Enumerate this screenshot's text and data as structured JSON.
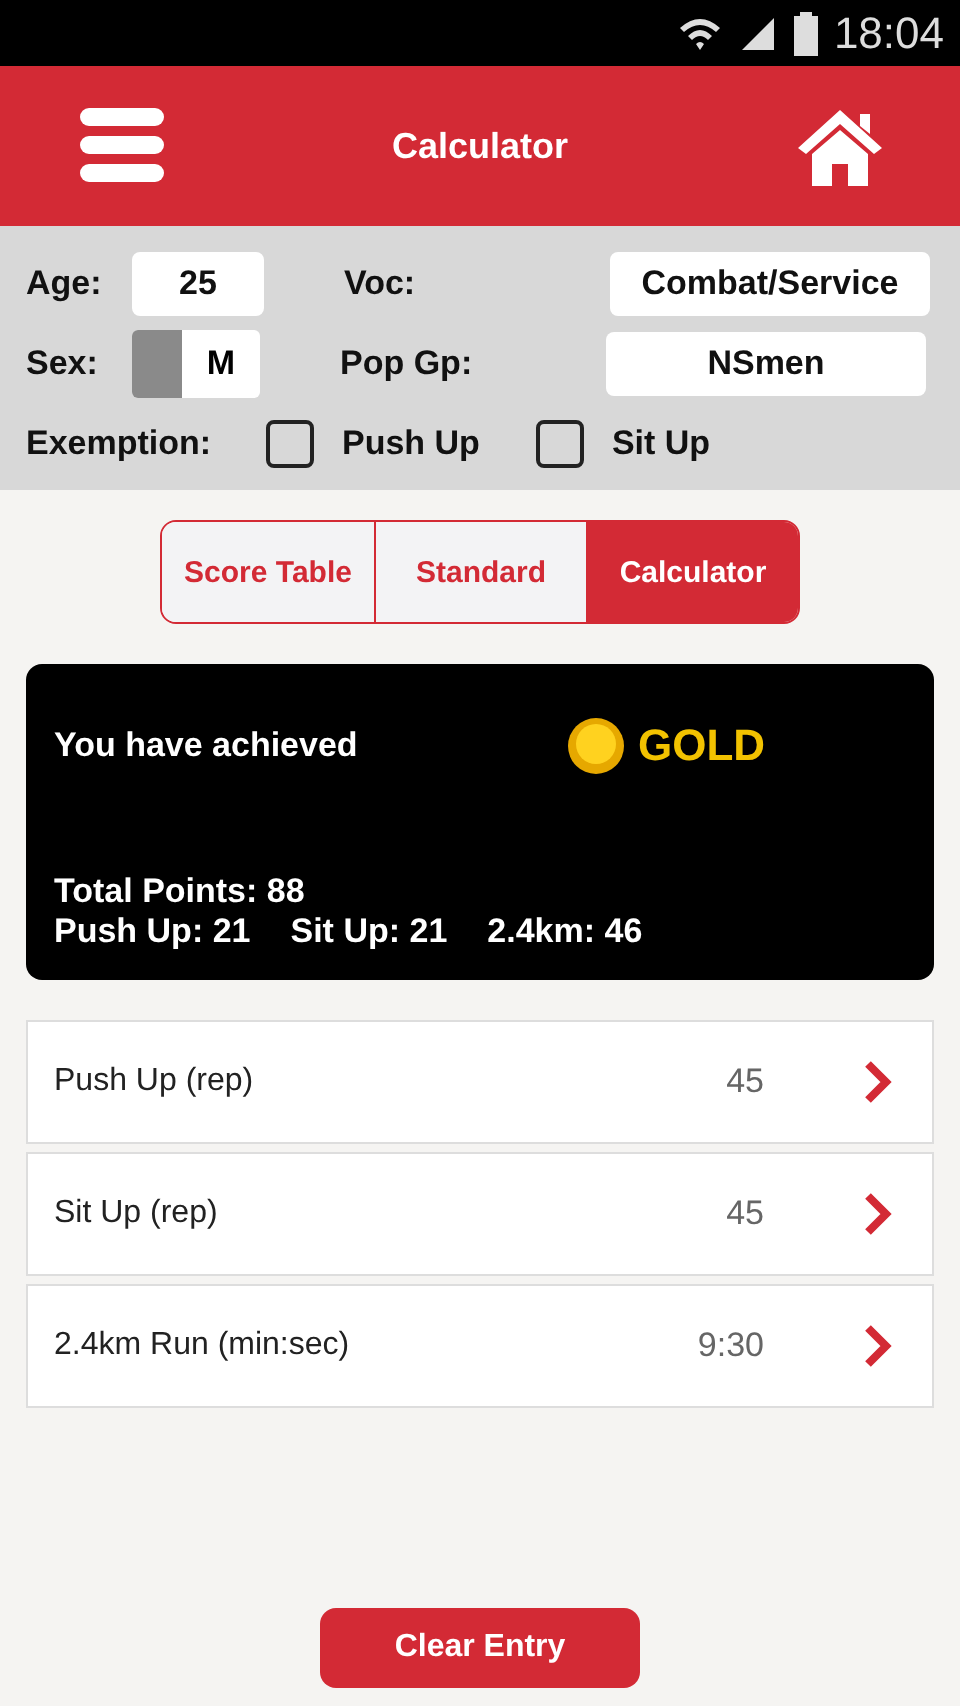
{
  "status_bar": {
    "time": "18:04"
  },
  "header": {
    "title": "Calculator"
  },
  "form": {
    "age_label": "Age:",
    "age": "25",
    "voc_label": "Voc:",
    "voc": "Combat/Service",
    "sex_label": "Sex:",
    "sex": "M",
    "pop_label": "Pop Gp:",
    "pop": "NSmen",
    "exemption_label": "Exemption:",
    "exemptions": [
      {
        "label": "Push Up",
        "checked": false
      },
      {
        "label": "Sit Up",
        "checked": false
      }
    ]
  },
  "tabs": [
    {
      "label": "Score Table",
      "selected": false
    },
    {
      "label": "Standard",
      "selected": false
    },
    {
      "label": "Calculator",
      "selected": true
    }
  ],
  "result": {
    "heading": "You have achieved",
    "award": "GOLD",
    "total": "Total Points: 88",
    "stats": [
      "Push Up: 21",
      "Sit Up: 21",
      "2.4km: 46"
    ]
  },
  "entries": [
    {
      "label": "Push Up (rep)",
      "value": "45"
    },
    {
      "label": "Sit Up (rep)",
      "value": "45"
    },
    {
      "label": "2.4km Run (min:sec)",
      "value": "9:30"
    }
  ],
  "clear_button": "Clear Entry"
}
